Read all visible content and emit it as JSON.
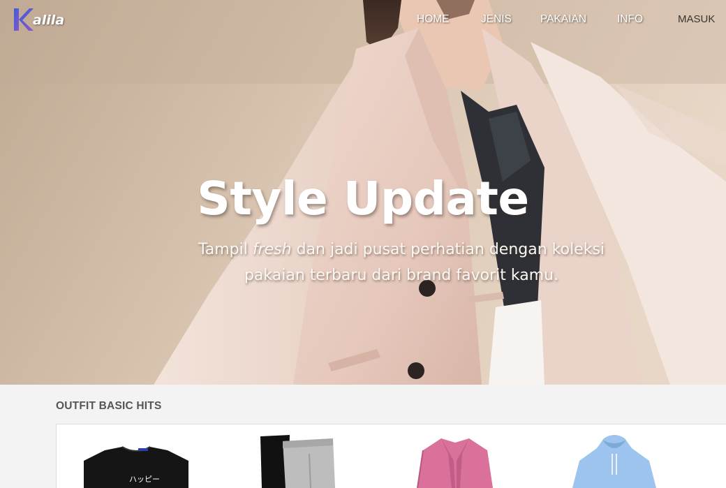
{
  "brand": {
    "name": "alila",
    "logo_letter": "K"
  },
  "nav": {
    "items": [
      "HOME",
      "JENIS",
      "PAKAIAN",
      "INFO"
    ],
    "login": "MASUK"
  },
  "hero": {
    "title": "Style Update",
    "subtitle_part1": "Tampil ",
    "subtitle_em": "fresh",
    "subtitle_part2": " dan jadi pusat perhatian dengan koleksi pakaian terbaru dari brand favorit kamu."
  },
  "section": {
    "title": "OUTFIT BASIC HITS",
    "products": [
      {
        "name": "black-tshirt",
        "print": "ハッピー"
      },
      {
        "name": "jogger-pants"
      },
      {
        "name": "pink-cardigan"
      },
      {
        "name": "blue-hoodie"
      }
    ]
  },
  "colors": {
    "logo_blue": "#3a5fd9",
    "logo_purple": "#7b52c9",
    "nav_text": "#ffffff",
    "section_bg": "#f3f3f3"
  }
}
